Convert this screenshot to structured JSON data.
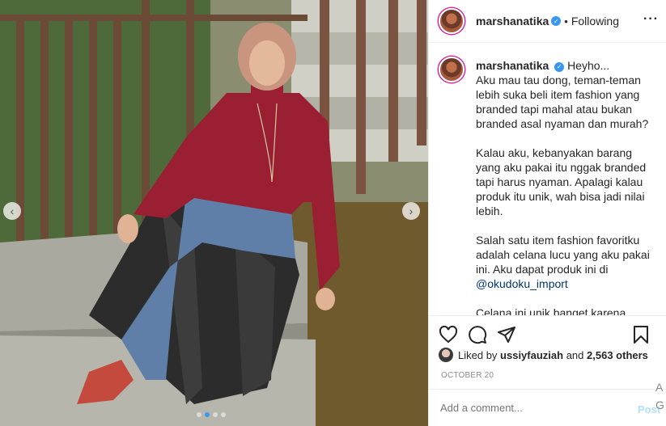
{
  "post": {
    "username": "marshanatika",
    "verified": true,
    "follow_state": "Following",
    "bullet": "•",
    "more_glyph": "···"
  },
  "caption": {
    "author": "marshanatika",
    "paragraphs": [
      "Heyho...\nAku mau tau dong, teman-teman lebih suka beli item fashion yang branded tapi mahal atau bukan branded asal nyaman dan murah?",
      "Kalau aku, kebanyakan barang yang aku pakai itu nggak branded tapi harus nyaman. Apalagi kalau produk itu unik, wah bisa jadi nilai lebih.",
      "Salah satu item fashion favoritku adalah celana lucu yang aku pakai ini. Aku dapat produk ini di",
      "Celana ini unik banget karena perpaduan antara jeans sama bahan plits. Semua produk di"
    ],
    "mention": "@okudoku_import"
  },
  "likes": {
    "prefix": "Liked by",
    "user": "ussiyfauziah",
    "middle": "and",
    "others": "2,563 others"
  },
  "date": "OCTOBER 20",
  "comment": {
    "placeholder": "Add a comment...",
    "post_label": "Post"
  },
  "edge_text": {
    "a": "A",
    "g": "G"
  },
  "carousel": {
    "dot_count": 4,
    "active_dot": 1
  },
  "colors": {
    "accent": "#3897f0",
    "text": "#262626",
    "muted": "#8e8e8e",
    "mention": "#00376b",
    "post_disabled": "#b2dffc",
    "turtleneck": "#9b1f32",
    "hijab": "#c9957f"
  },
  "icons": [
    "heart-icon",
    "comment-icon",
    "share-icon",
    "bookmark-icon",
    "verified-badge-icon",
    "more-options-icon",
    "chevron-left-icon",
    "chevron-right-icon"
  ]
}
